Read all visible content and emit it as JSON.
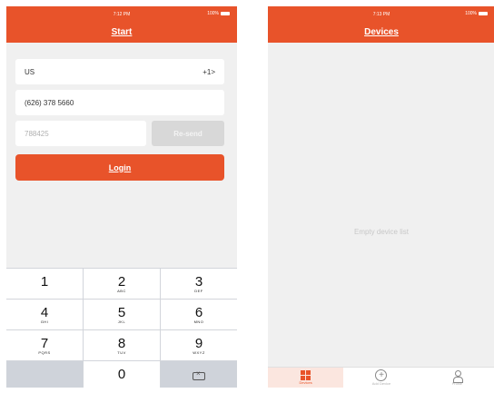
{
  "start_screen": {
    "status_time": "7:12 PM",
    "status_battery": "100%",
    "title": "Start",
    "country": "US",
    "country_code": "+1>",
    "phone_number": "(626) 378 5660",
    "verification_code": "788425",
    "resend_label": "Re-send",
    "login_label": "Login",
    "keypad": [
      {
        "digit": "1",
        "letters": ""
      },
      {
        "digit": "2",
        "letters": "ABC"
      },
      {
        "digit": "3",
        "letters": "DEF"
      },
      {
        "digit": "4",
        "letters": "GHI"
      },
      {
        "digit": "5",
        "letters": "JKL"
      },
      {
        "digit": "6",
        "letters": "MNO"
      },
      {
        "digit": "7",
        "letters": "PQRS"
      },
      {
        "digit": "8",
        "letters": "TUV"
      },
      {
        "digit": "9",
        "letters": "WXYZ"
      },
      {
        "digit": "0",
        "letters": ""
      }
    ],
    "backspace_icon": "backspace-icon"
  },
  "devices_screen": {
    "status_time": "7:13 PM",
    "status_battery": "100%",
    "title": "Devices",
    "empty_text": "Empty device list",
    "tabs": [
      {
        "label": "Devices",
        "icon": "grid-icon"
      },
      {
        "label": "Add Device",
        "icon": "plus-circle-icon"
      },
      {
        "label": "Profile",
        "icon": "user-icon"
      }
    ],
    "accent_color": "#e8532a"
  }
}
